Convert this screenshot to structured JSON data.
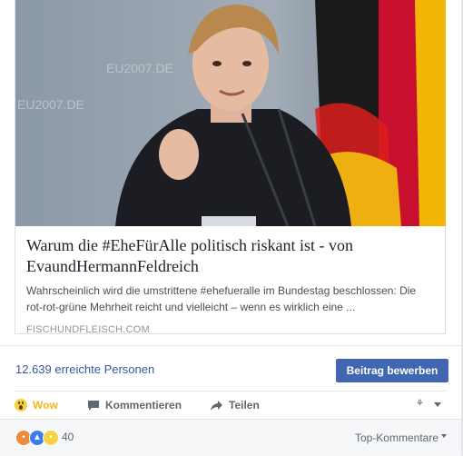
{
  "link_preview": {
    "title": "Warum die #EheFürAlle politisch riskant ist - von EvaundHermannFeldreich",
    "description": "Wahrscheinlich wird die umstrittene #ehefueralle im Bundestag beschlossen: Die rot-rot-grüne Mehrheit reicht und vielleicht – wenn es wirklich eine ...",
    "domain": "FISCHUNDFLEISCH.COM",
    "image_backdrop_text_1": "EU2007.DE",
    "image_backdrop_text_2": "EU2007.DE"
  },
  "stats": {
    "reach_text": "12.639 erreichte Personen",
    "promote_label": "Beitrag bewerben"
  },
  "actions": {
    "wow_label": "Wow",
    "comment_label": "Kommentieren",
    "share_label": "Teilen"
  },
  "reactions": {
    "count": "40",
    "sort_label": "Top-Kommentare"
  },
  "colors": {
    "link_blue": "#365899",
    "button_blue": "#4267b2",
    "wow_yellow": "#f0ba15"
  }
}
